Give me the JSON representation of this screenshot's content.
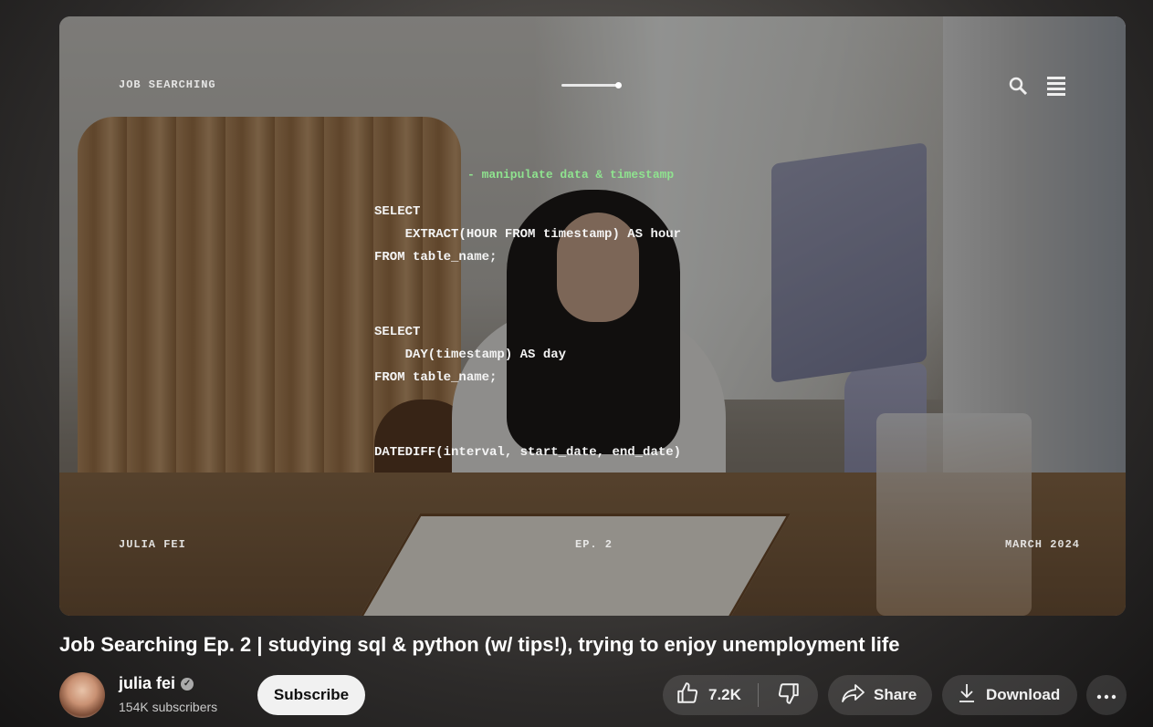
{
  "video": {
    "overlay_top_left": "JOB SEARCHING",
    "overlay_bottom_left": "JULIA FEI",
    "overlay_bottom_center": "EP. 2",
    "overlay_bottom_right": "MARCH 2024",
    "code_comment": "- manipulate data & timestamp",
    "code_block_1": "SELECT\n    EXTRACT(HOUR FROM timestamp) AS hour\nFROM table_name;",
    "code_block_2": "SELECT\n    DAY(timestamp) AS day\nFROM table_name;",
    "code_block_3": "DATEDIFF(interval, start_date, end_date)"
  },
  "title": "Job Searching Ep. 2 | studying sql & python (w/ tips!), trying to enjoy unemployment life",
  "channel": {
    "name": "julia fei",
    "verified": true,
    "subscribers": "154K subscribers"
  },
  "actions": {
    "subscribe_label": "Subscribe",
    "like_count": "7.2K",
    "share_label": "Share",
    "download_label": "Download"
  }
}
